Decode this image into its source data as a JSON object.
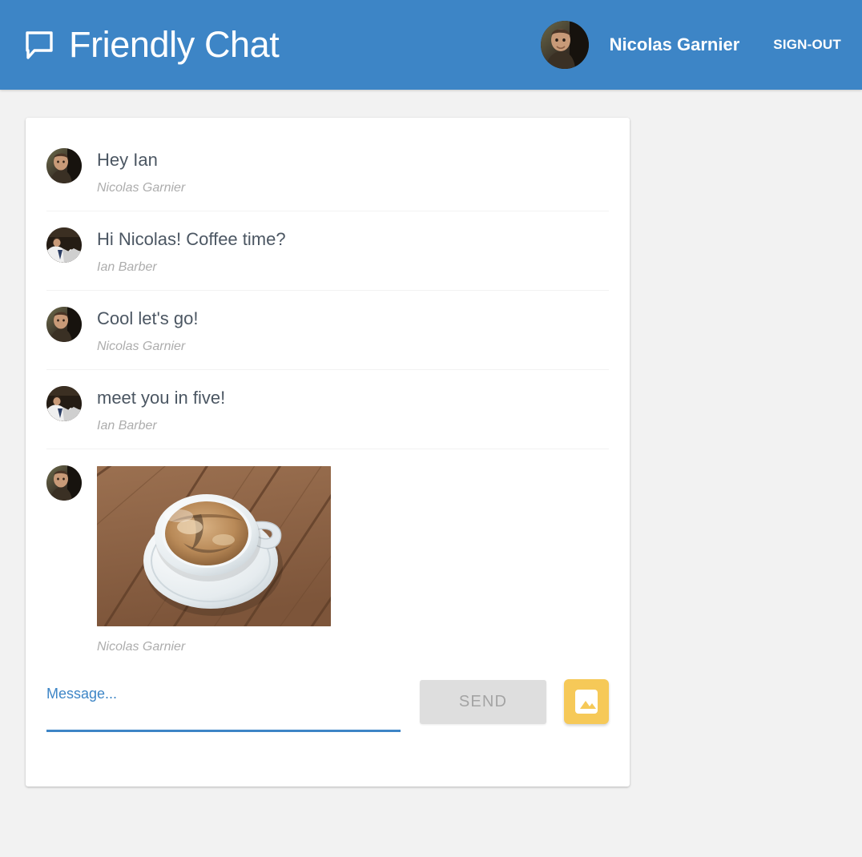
{
  "header": {
    "title": "Friendly Chat",
    "logo_icon": "chat-bubble-icon",
    "user_name": "Nicolas Garnier",
    "sign_out_label": "SIGN-OUT",
    "avatar_alt": "Nicolas Garnier",
    "background_color": "#3D85C6",
    "text_color": "#FFFFFF"
  },
  "messages": [
    {
      "text": "Hey Ian",
      "author": "Nicolas Garnier",
      "avatar": "nicolas",
      "type": "text"
    },
    {
      "text": "Hi Nicolas! Coffee time?",
      "author": "Ian Barber",
      "avatar": "ian",
      "type": "text"
    },
    {
      "text": "Cool let's go!",
      "author": "Nicolas Garnier",
      "avatar": "nicolas",
      "type": "text"
    },
    {
      "text": "meet you in five!",
      "author": "Ian Barber",
      "avatar": "ian",
      "type": "text"
    },
    {
      "text": "",
      "author": "Nicolas Garnier",
      "avatar": "nicolas",
      "type": "image",
      "image_alt": "coffee-cup-on-wooden-table"
    }
  ],
  "composer": {
    "label": "Message...",
    "value": "",
    "placeholder": "",
    "send_label": "SEND",
    "send_disabled": true,
    "image_button_icon": "image-icon",
    "label_color": "#3D85C6",
    "underline_color": "#3D85C6",
    "send_bg_color": "#DEDEDE",
    "send_text_color": "#A4A4A4",
    "image_button_color": "#F6C958"
  },
  "theme": {
    "page_background": "#F2F2F2",
    "card_background": "#FFFFFF",
    "message_text_color": "#4B5662",
    "author_text_color": "#ADADAD",
    "divider_color": "#F2F2F2"
  }
}
